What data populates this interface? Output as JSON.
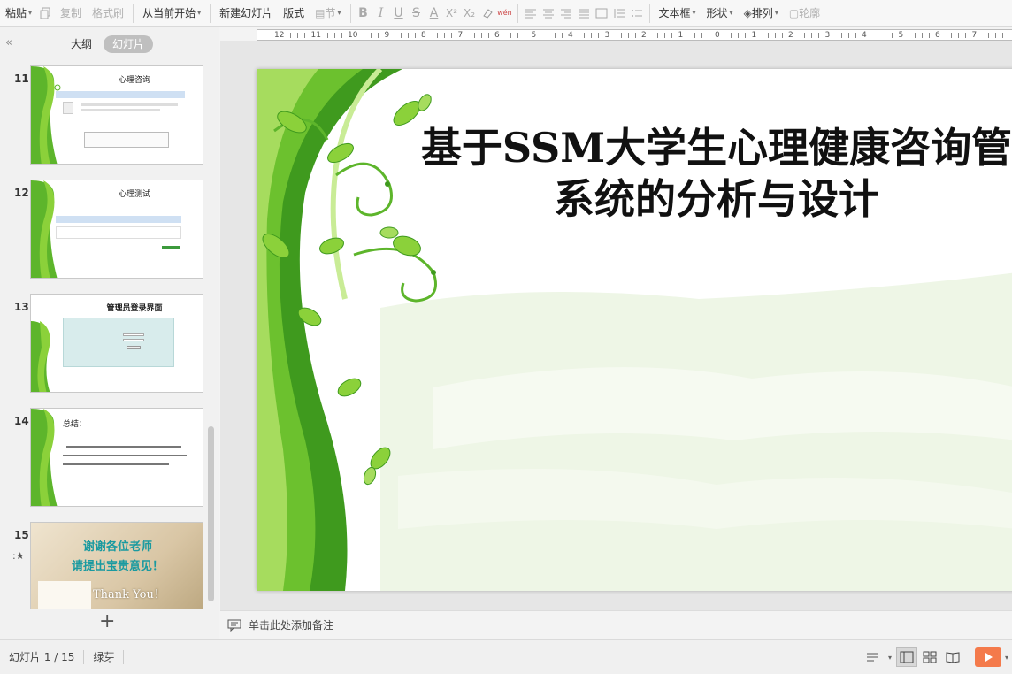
{
  "ribbon": {
    "paste": "粘贴",
    "copy": "复制",
    "format_painter": "格式刷",
    "from_current": "从当前开始",
    "new_slide": "新建幻灯片",
    "layout": "版式",
    "section": "节",
    "text_box": "文本框",
    "shape": "形状",
    "arrange": "排列",
    "outline": "轮廓"
  },
  "left_panel": {
    "tab_outline": "大纲",
    "tab_slides": "幻灯片",
    "thumbs": [
      {
        "num": "11",
        "title": "心理咨询"
      },
      {
        "num": "12",
        "title": "心理测试"
      },
      {
        "num": "13",
        "title": "管理员登录界面"
      },
      {
        "num": "14",
        "title": "总结："
      },
      {
        "num": "15",
        "title": "谢谢各位老师",
        "title2": "请提出宝贵意见！",
        "title3": "Thank You！"
      }
    ]
  },
  "slide": {
    "title_line1": "基于SSM大学生心理健康咨询管",
    "title_line2": "系统的分析与设计"
  },
  "notes": {
    "placeholder": "单击此处添加备注"
  },
  "status": {
    "slide_counter": "幻灯片 1 / 15",
    "theme": "绿芽"
  },
  "ruler": {
    "labels": [
      "12",
      "11",
      "10",
      "9",
      "8",
      "7",
      "6",
      "5",
      "4",
      "3",
      "2",
      "1",
      "0",
      "1",
      "2",
      "3",
      "4",
      "5",
      "6",
      "7"
    ]
  },
  "colors": {
    "vine_dark": "#3f9a1e",
    "vine_light": "#8bd13a",
    "play": "#f47a4b"
  }
}
